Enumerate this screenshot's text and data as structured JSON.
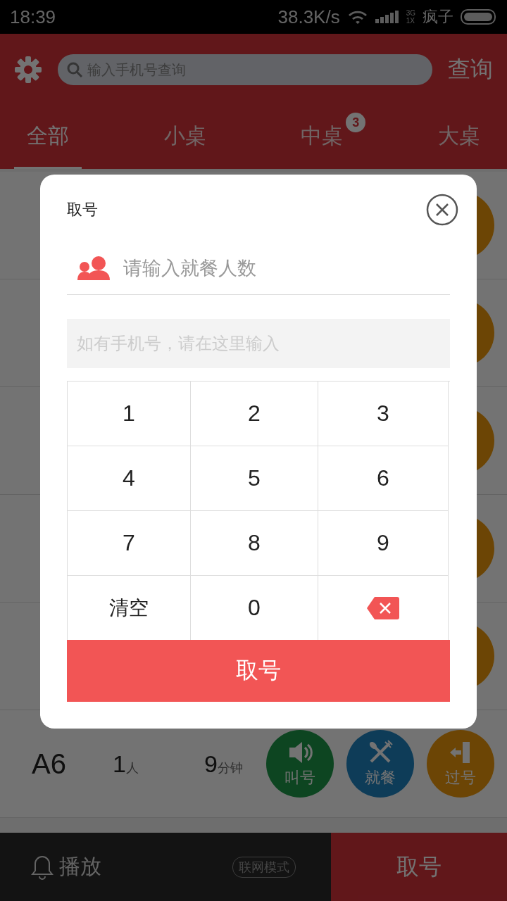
{
  "status_bar": {
    "time": "18:39",
    "speed": "38.3K/s",
    "network_top": "3G",
    "network_bottom": "1X",
    "carrier": "疯子"
  },
  "header": {
    "search_placeholder": "输入手机号查询",
    "query_button": "查询",
    "tabs": [
      {
        "label": "全部",
        "selected": true
      },
      {
        "label": "小桌",
        "selected": false
      },
      {
        "label": "中桌",
        "selected": false,
        "badge": "3"
      },
      {
        "label": "大桌",
        "selected": false
      }
    ]
  },
  "queue": [
    {
      "actions": [
        {
          "kind": "skip"
        }
      ]
    },
    {
      "actions": [
        {
          "kind": "skip"
        }
      ]
    },
    {
      "actions": [
        {
          "kind": "skip"
        }
      ]
    },
    {
      "actions": [
        {
          "kind": "skip"
        }
      ]
    },
    {
      "actions": [
        {
          "kind": "skip"
        }
      ]
    },
    {
      "code": "A6",
      "people": "1",
      "people_unit": "人",
      "wait": "9",
      "wait_unit": "分钟",
      "actions": [
        {
          "kind": "call",
          "label": "叫号"
        },
        {
          "kind": "dine",
          "label": "就餐"
        },
        {
          "kind": "skip",
          "label": "过号"
        }
      ]
    }
  ],
  "bottom_bar": {
    "play": "播放",
    "mode": "联网模式",
    "take": "取号"
  },
  "dialog": {
    "title": "取号",
    "people_placeholder": "请输入就餐人数",
    "phone_placeholder": "如有手机号，请在这里输入",
    "keys": [
      {
        "kind": "digit",
        "label": "1"
      },
      {
        "kind": "digit",
        "label": "2"
      },
      {
        "kind": "digit",
        "label": "3"
      },
      {
        "kind": "digit",
        "label": "4"
      },
      {
        "kind": "digit",
        "label": "5"
      },
      {
        "kind": "digit",
        "label": "6"
      },
      {
        "kind": "digit",
        "label": "7"
      },
      {
        "kind": "digit",
        "label": "8"
      },
      {
        "kind": "digit",
        "label": "9"
      },
      {
        "kind": "clear",
        "label": "清空"
      },
      {
        "kind": "digit",
        "label": "0"
      },
      {
        "kind": "backspace"
      }
    ],
    "submit": "取号"
  }
}
